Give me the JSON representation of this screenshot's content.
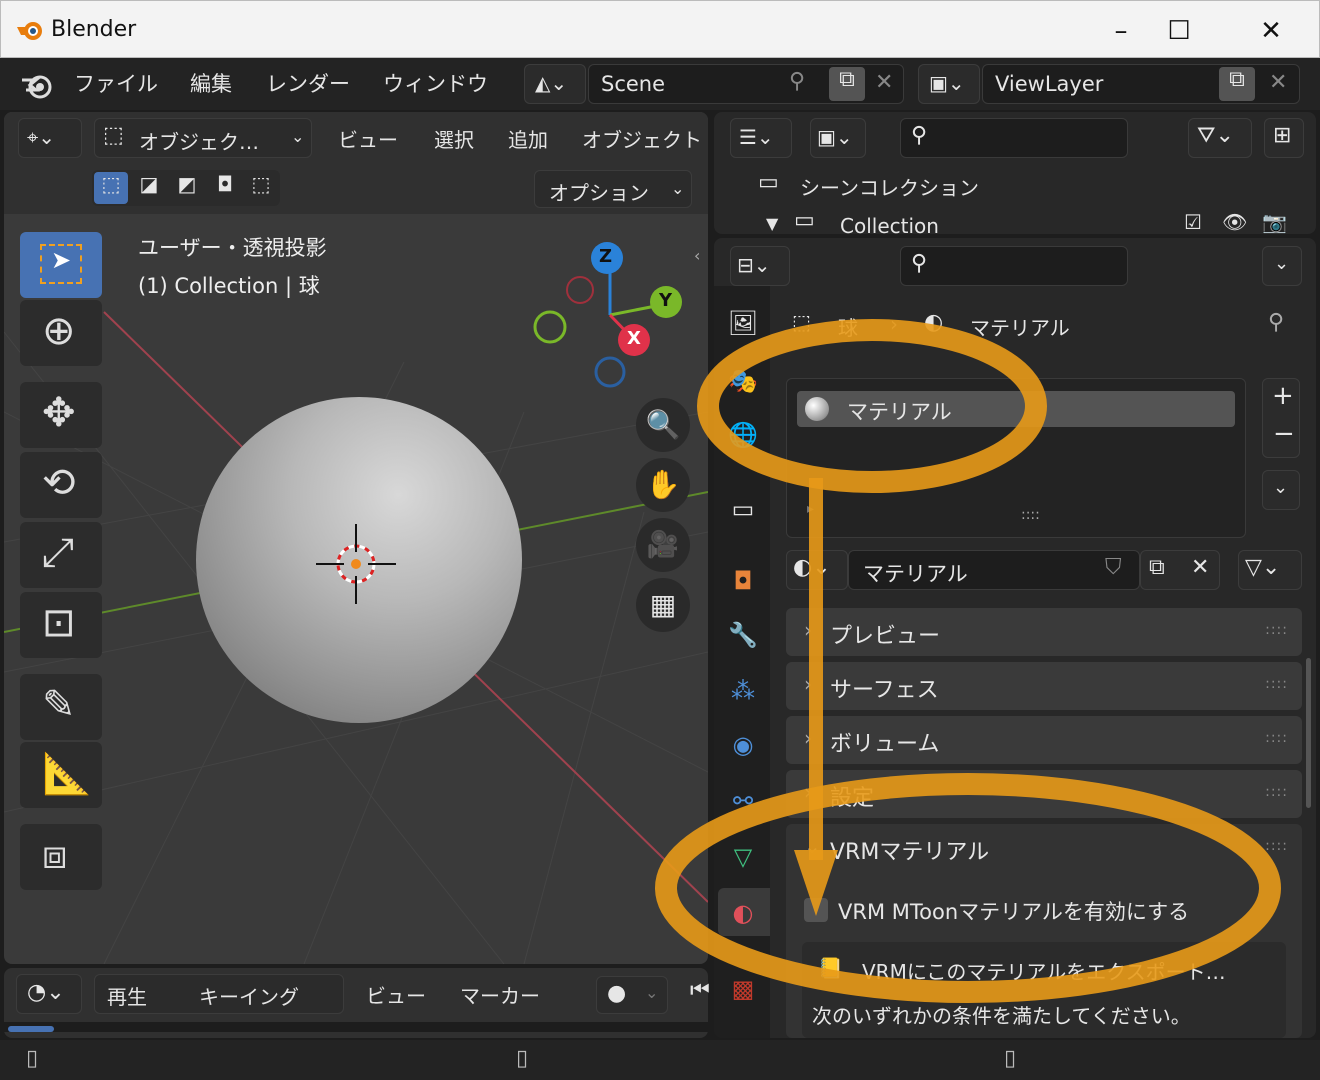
{
  "window": {
    "title": "Blender",
    "controls": [
      "–",
      "☐",
      "✕"
    ]
  },
  "menu": {
    "items": [
      "ファイル",
      "編集",
      "レンダー",
      "ウィンドウ"
    ],
    "scene": "Scene",
    "view_layer": "ViewLayer"
  },
  "viewport": {
    "mode": "オブジェク…",
    "menus": [
      "ビュー",
      "選択",
      "追加",
      "オブジェクト"
    ],
    "options": "オプション",
    "overlay_line1": "ユーザー・透視投影",
    "overlay_line2": "(1) Collection | 球",
    "gizmo": {
      "z": "Z",
      "y": "Y",
      "x": "X"
    }
  },
  "timeline": {
    "items": [
      "再生",
      "キーイング",
      "ビュー",
      "マーカー"
    ]
  },
  "outliner": {
    "scene_collection": "シーンコレクション",
    "collection": "Collection"
  },
  "properties": {
    "breadcrumb_object": "球",
    "breadcrumb_material": "マテリアル",
    "slot_name": "マテリアル",
    "material_name": "マテリアル",
    "panels": [
      "プレビュー",
      "サーフェス",
      "ボリューム",
      "設定",
      "VRMマテリアル"
    ],
    "grip": "::::",
    "checkbox_label": "VRM MToonマテリアルを有効にする",
    "export_label": "VRMにこのマテリアルをエクスポート…",
    "condition_text": "次のいずれかの条件を満たしてください。"
  },
  "colors": {
    "accent_blue": "#4772b3",
    "annotation_orange": "#e89a18",
    "axis_x": "#e0324a",
    "axis_y": "#7ab829",
    "axis_z": "#2a82d9"
  }
}
